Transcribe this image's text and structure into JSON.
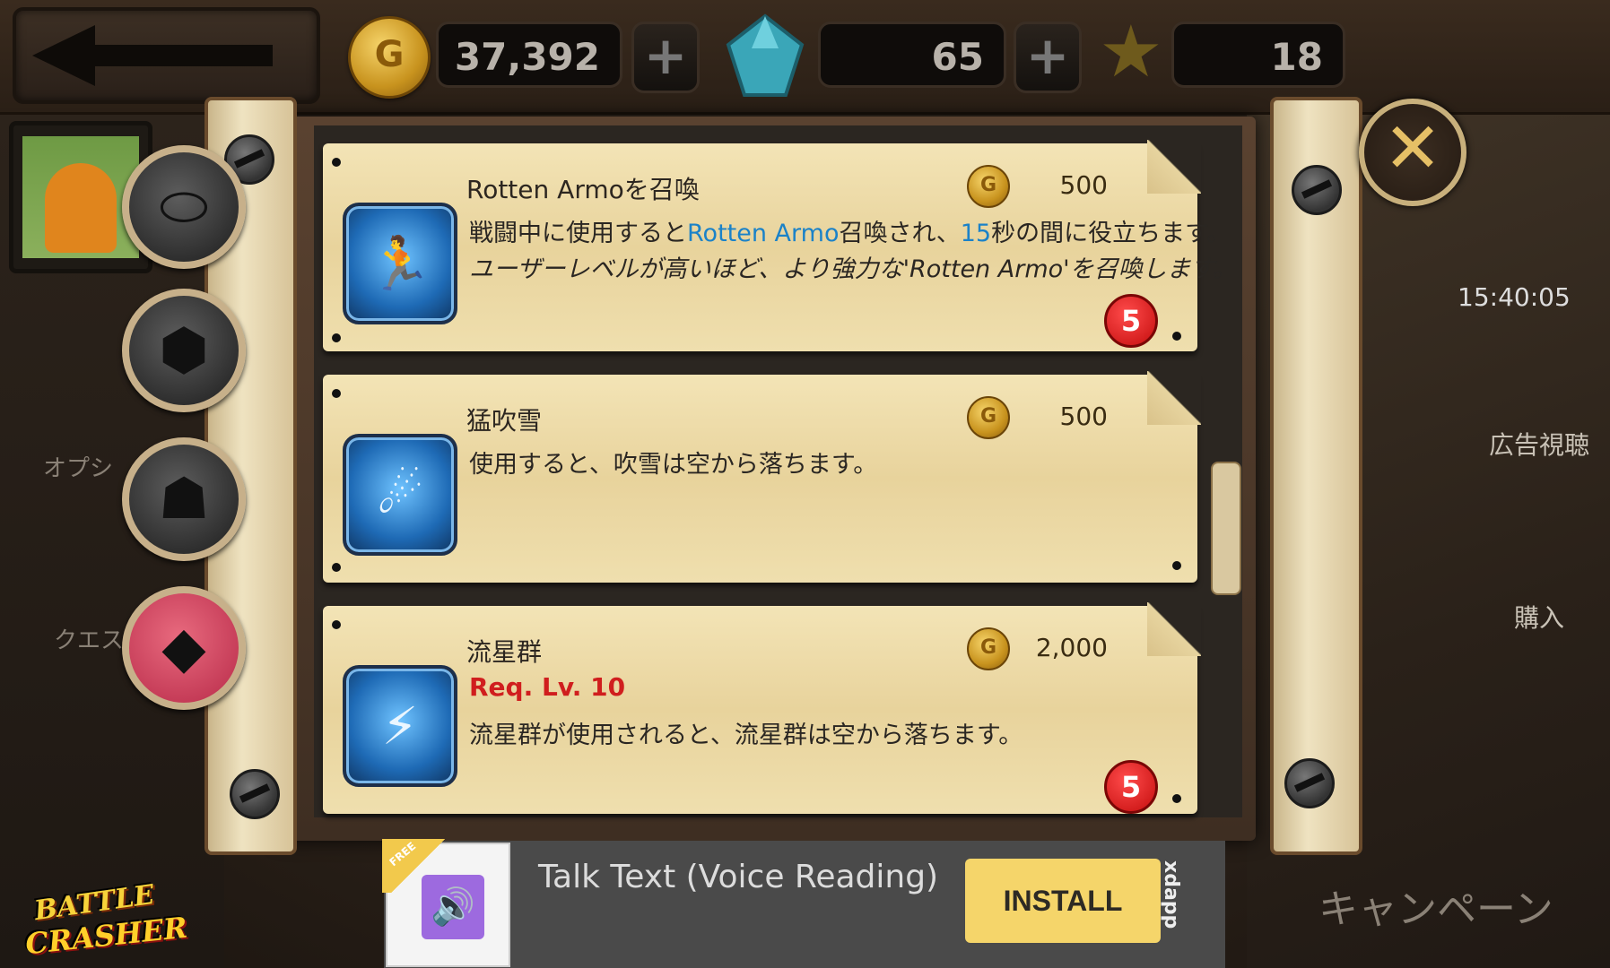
{
  "header": {
    "gold": "37,392",
    "gems": "65",
    "stars": "18",
    "coin_glyph": "G"
  },
  "right_panel": {
    "timer": "15:40:05",
    "ad_label": "広告視聴",
    "buy_label": "購入",
    "campaign_label": "キャンペーン"
  },
  "left_panel": {
    "option_label": "オプシ",
    "quest_label": "クエス"
  },
  "close_label": "✕",
  "items": [
    {
      "name": "Rotten Armoを召喚",
      "price": "500",
      "desc_prefix": "戦闘中に使用すると",
      "desc_hl1": "Rotten Armo",
      "desc_mid": "召喚され、",
      "desc_hl2": "15",
      "desc_suffix": "秒の間に役立ちます。",
      "desc2": "ユーザーレベルが高いほど、より強力な'Rotten Armo'を召喚します。",
      "count": "5",
      "icon": "running-figure-icon"
    },
    {
      "name": "猛吹雪",
      "price": "500",
      "desc": "使用すると、吹雪は空から落ちます。",
      "icon": "blizzard-icon"
    },
    {
      "name": "流星群",
      "price": "2,000",
      "req": "Req. Lv. 10",
      "desc": "流星群が使用されると、流星群は空から落ちます。",
      "count": "5",
      "icon": "meteor-shower-icon"
    }
  ],
  "ad": {
    "free_tag": "FREE",
    "title": "Talk Text (Voice Reading)",
    "install": "INSTALL",
    "brand": "xdapp"
  },
  "logo": {
    "line1": "BATTLE",
    "line2": "CRASHER"
  },
  "colors": {
    "highlight": "#1b82c8",
    "req": "#d01e1e",
    "badge": "#c40d0d",
    "install_bg": "#f5d56a"
  }
}
